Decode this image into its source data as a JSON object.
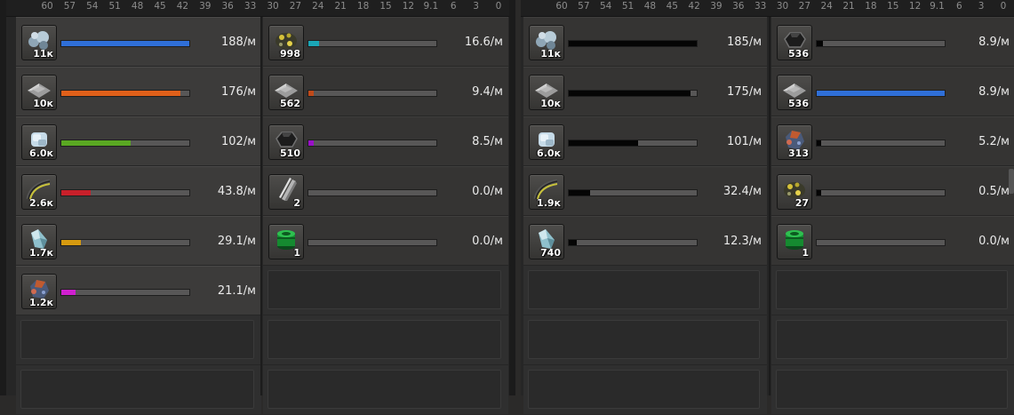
{
  "axis_left": [
    "60",
    "57",
    "54",
    "51",
    "48",
    "45",
    "42",
    "39",
    "36",
    "33",
    "30",
    "27",
    "24",
    "21",
    "18",
    "15",
    "12",
    "9.1",
    "6",
    "3",
    "0"
  ],
  "axis_right": [
    "60",
    "57",
    "54",
    "51",
    "48",
    "45",
    "42",
    "39",
    "36",
    "33",
    "30",
    "27",
    "24",
    "21",
    "18",
    "15",
    "12",
    "9.1",
    "6",
    "3",
    "0"
  ],
  "panels": [
    {
      "columns": [
        [
          {
            "icon": "stone-icon",
            "count": "11к",
            "rate": "188/м",
            "fill": 1.0,
            "color": "#2f6fd8"
          },
          {
            "icon": "iron-plate-icon",
            "count": "10к",
            "rate": "176/м",
            "fill": 0.93,
            "color": "#e0601a"
          },
          {
            "icon": "ice-icon",
            "count": "6.0к",
            "rate": "102/м",
            "fill": 0.54,
            "color": "#5aa822"
          },
          {
            "icon": "rail-icon",
            "count": "2.6к",
            "rate": "43.8/м",
            "fill": 0.23,
            "color": "#c8202a"
          },
          {
            "icon": "crystal-icon",
            "count": "1.7к",
            "rate": "29.1/м",
            "fill": 0.15,
            "color": "#d69a10"
          },
          {
            "icon": "ore-chunk-icon",
            "count": "1.2к",
            "rate": "21.1/м",
            "fill": 0.11,
            "color": "#d020d0"
          }
        ],
        [
          {
            "icon": "gold-ore-icon",
            "count": "998",
            "rate": "16.6/м",
            "fill": 0.08,
            "color": "#1aa6b6"
          },
          {
            "icon": "iron-plate-icon",
            "count": "562",
            "rate": "9.4/м",
            "fill": 0.04,
            "color": "#c04a1a"
          },
          {
            "icon": "coal-icon",
            "count": "510",
            "rate": "8.5/м",
            "fill": 0.04,
            "color": "#9a10c8"
          },
          {
            "icon": "beam-icon",
            "count": "2",
            "rate": "0.0/м",
            "fill": 0.0,
            "color": "#666666"
          },
          {
            "icon": "barrel-icon",
            "count": "1",
            "rate": "0.0/м",
            "fill": 0.0,
            "color": "#666666"
          }
        ]
      ]
    },
    {
      "columns": [
        [
          {
            "icon": "stone-icon",
            "count": "11к",
            "rate": "185/м",
            "fill": 1.0,
            "color": "#050505"
          },
          {
            "icon": "iron-plate-icon",
            "count": "10к",
            "rate": "175/м",
            "fill": 0.95,
            "color": "#050505"
          },
          {
            "icon": "ice-icon",
            "count": "6.0к",
            "rate": "101/м",
            "fill": 0.54,
            "color": "#050505"
          },
          {
            "icon": "rail-icon",
            "count": "1.9к",
            "rate": "32.4/м",
            "fill": 0.17,
            "color": "#050505"
          },
          {
            "icon": "crystal-icon",
            "count": "740",
            "rate": "12.3/м",
            "fill": 0.06,
            "color": "#050505"
          }
        ],
        [
          {
            "icon": "coal-icon",
            "count": "536",
            "rate": "8.9/м",
            "fill": 0.05,
            "color": "#050505"
          },
          {
            "icon": "iron-plate-icon",
            "count": "536",
            "rate": "8.9/м",
            "fill": 1.0,
            "color": "#2f6fd8"
          },
          {
            "icon": "ore-chunk-icon",
            "count": "313",
            "rate": "5.2/м",
            "fill": 0.03,
            "color": "#050505"
          },
          {
            "icon": "gold-ore-icon",
            "count": "27",
            "rate": "0.5/м",
            "fill": 0.01,
            "color": "#050505"
          },
          {
            "icon": "barrel-icon",
            "count": "1",
            "rate": "0.0/м",
            "fill": 0.0,
            "color": "#050505"
          }
        ]
      ]
    }
  ]
}
